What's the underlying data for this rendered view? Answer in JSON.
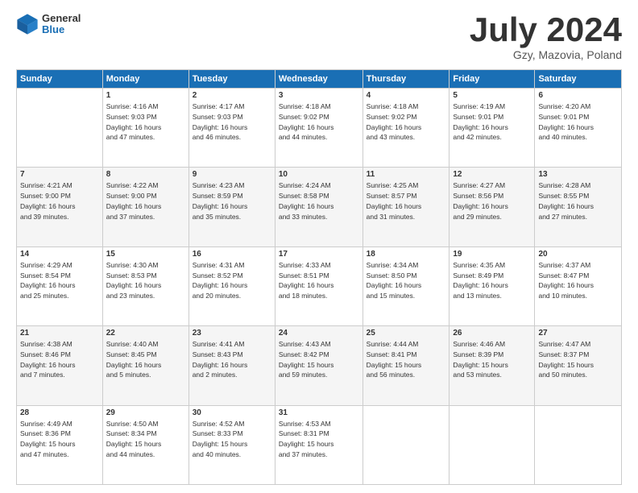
{
  "logo": {
    "general": "General",
    "blue": "Blue"
  },
  "title": "July 2024",
  "subtitle": "Gzy, Mazovia, Poland",
  "days_of_week": [
    "Sunday",
    "Monday",
    "Tuesday",
    "Wednesday",
    "Thursday",
    "Friday",
    "Saturday"
  ],
  "weeks": [
    [
      {
        "day": "",
        "info": ""
      },
      {
        "day": "1",
        "info": "Sunrise: 4:16 AM\nSunset: 9:03 PM\nDaylight: 16 hours\nand 47 minutes."
      },
      {
        "day": "2",
        "info": "Sunrise: 4:17 AM\nSunset: 9:03 PM\nDaylight: 16 hours\nand 46 minutes."
      },
      {
        "day": "3",
        "info": "Sunrise: 4:18 AM\nSunset: 9:02 PM\nDaylight: 16 hours\nand 44 minutes."
      },
      {
        "day": "4",
        "info": "Sunrise: 4:18 AM\nSunset: 9:02 PM\nDaylight: 16 hours\nand 43 minutes."
      },
      {
        "day": "5",
        "info": "Sunrise: 4:19 AM\nSunset: 9:01 PM\nDaylight: 16 hours\nand 42 minutes."
      },
      {
        "day": "6",
        "info": "Sunrise: 4:20 AM\nSunset: 9:01 PM\nDaylight: 16 hours\nand 40 minutes."
      }
    ],
    [
      {
        "day": "7",
        "info": "Sunrise: 4:21 AM\nSunset: 9:00 PM\nDaylight: 16 hours\nand 39 minutes."
      },
      {
        "day": "8",
        "info": "Sunrise: 4:22 AM\nSunset: 9:00 PM\nDaylight: 16 hours\nand 37 minutes."
      },
      {
        "day": "9",
        "info": "Sunrise: 4:23 AM\nSunset: 8:59 PM\nDaylight: 16 hours\nand 35 minutes."
      },
      {
        "day": "10",
        "info": "Sunrise: 4:24 AM\nSunset: 8:58 PM\nDaylight: 16 hours\nand 33 minutes."
      },
      {
        "day": "11",
        "info": "Sunrise: 4:25 AM\nSunset: 8:57 PM\nDaylight: 16 hours\nand 31 minutes."
      },
      {
        "day": "12",
        "info": "Sunrise: 4:27 AM\nSunset: 8:56 PM\nDaylight: 16 hours\nand 29 minutes."
      },
      {
        "day": "13",
        "info": "Sunrise: 4:28 AM\nSunset: 8:55 PM\nDaylight: 16 hours\nand 27 minutes."
      }
    ],
    [
      {
        "day": "14",
        "info": "Sunrise: 4:29 AM\nSunset: 8:54 PM\nDaylight: 16 hours\nand 25 minutes."
      },
      {
        "day": "15",
        "info": "Sunrise: 4:30 AM\nSunset: 8:53 PM\nDaylight: 16 hours\nand 23 minutes."
      },
      {
        "day": "16",
        "info": "Sunrise: 4:31 AM\nSunset: 8:52 PM\nDaylight: 16 hours\nand 20 minutes."
      },
      {
        "day": "17",
        "info": "Sunrise: 4:33 AM\nSunset: 8:51 PM\nDaylight: 16 hours\nand 18 minutes."
      },
      {
        "day": "18",
        "info": "Sunrise: 4:34 AM\nSunset: 8:50 PM\nDaylight: 16 hours\nand 15 minutes."
      },
      {
        "day": "19",
        "info": "Sunrise: 4:35 AM\nSunset: 8:49 PM\nDaylight: 16 hours\nand 13 minutes."
      },
      {
        "day": "20",
        "info": "Sunrise: 4:37 AM\nSunset: 8:47 PM\nDaylight: 16 hours\nand 10 minutes."
      }
    ],
    [
      {
        "day": "21",
        "info": "Sunrise: 4:38 AM\nSunset: 8:46 PM\nDaylight: 16 hours\nand 7 minutes."
      },
      {
        "day": "22",
        "info": "Sunrise: 4:40 AM\nSunset: 8:45 PM\nDaylight: 16 hours\nand 5 minutes."
      },
      {
        "day": "23",
        "info": "Sunrise: 4:41 AM\nSunset: 8:43 PM\nDaylight: 16 hours\nand 2 minutes."
      },
      {
        "day": "24",
        "info": "Sunrise: 4:43 AM\nSunset: 8:42 PM\nDaylight: 15 hours\nand 59 minutes."
      },
      {
        "day": "25",
        "info": "Sunrise: 4:44 AM\nSunset: 8:41 PM\nDaylight: 15 hours\nand 56 minutes."
      },
      {
        "day": "26",
        "info": "Sunrise: 4:46 AM\nSunset: 8:39 PM\nDaylight: 15 hours\nand 53 minutes."
      },
      {
        "day": "27",
        "info": "Sunrise: 4:47 AM\nSunset: 8:37 PM\nDaylight: 15 hours\nand 50 minutes."
      }
    ],
    [
      {
        "day": "28",
        "info": "Sunrise: 4:49 AM\nSunset: 8:36 PM\nDaylight: 15 hours\nand 47 minutes."
      },
      {
        "day": "29",
        "info": "Sunrise: 4:50 AM\nSunset: 8:34 PM\nDaylight: 15 hours\nand 44 minutes."
      },
      {
        "day": "30",
        "info": "Sunrise: 4:52 AM\nSunset: 8:33 PM\nDaylight: 15 hours\nand 40 minutes."
      },
      {
        "day": "31",
        "info": "Sunrise: 4:53 AM\nSunset: 8:31 PM\nDaylight: 15 hours\nand 37 minutes."
      },
      {
        "day": "",
        "info": ""
      },
      {
        "day": "",
        "info": ""
      },
      {
        "day": "",
        "info": ""
      }
    ]
  ]
}
